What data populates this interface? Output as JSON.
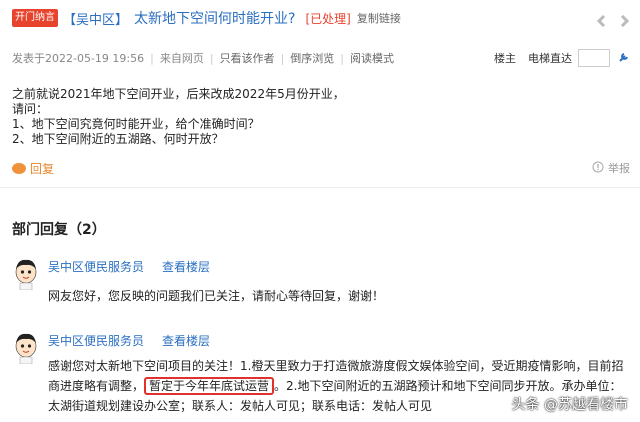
{
  "header": {
    "badge": "开门纳言",
    "district": "【吴中区】",
    "title": "太新地下空间何时能开业?",
    "status": "[已处理]",
    "copy_link": "复制链接"
  },
  "meta": {
    "posted": "发表于2022-05-19 19:56",
    "source": "来自网页",
    "only_author": "只看该作者",
    "reverse": "倒序浏览",
    "read_mode": "阅读模式",
    "floor_owner": "楼主",
    "jump_label": "电梯直达"
  },
  "question": {
    "lines": [
      "之前就说2021年地下空间开业，后来改成2022年5月份开业，",
      "请问：",
      "1、地下空间究竟何时能开业，给个准确时间？",
      "2、地下空间附近的五湖路、何时开放？"
    ]
  },
  "actions": {
    "reply": "回复",
    "report": "举报"
  },
  "section": {
    "title": "部门回复（2）"
  },
  "replies": [
    {
      "name": "吴中区便民服务员",
      "view_floor": "查看楼层",
      "text": "网友您好，您反映的问题我们已关注，请耐心等待回复，谢谢！"
    },
    {
      "name": "吴中区便民服务员",
      "view_floor": "查看楼层",
      "text_before": "感谢您对太新地下空间项目的关注！1.橙天里致力于打造微旅游度假文娱体验空间，受近期疫情影响，目前招商进度略有调整，",
      "text_highlight": "暂定于今年年底试运营",
      "text_after": "。2.地下空间附近的五湖路预计和地下空间同步开放。承办单位：太湖街道规划建设办公室；联系人：发帖人可见；联系电话：发帖人可见"
    }
  ],
  "watermark": "头条 @苏越看楼市",
  "colors": {
    "link": "#2a6fc0",
    "accent_red": "#e8432d",
    "reply_orange": "#e8862d"
  }
}
